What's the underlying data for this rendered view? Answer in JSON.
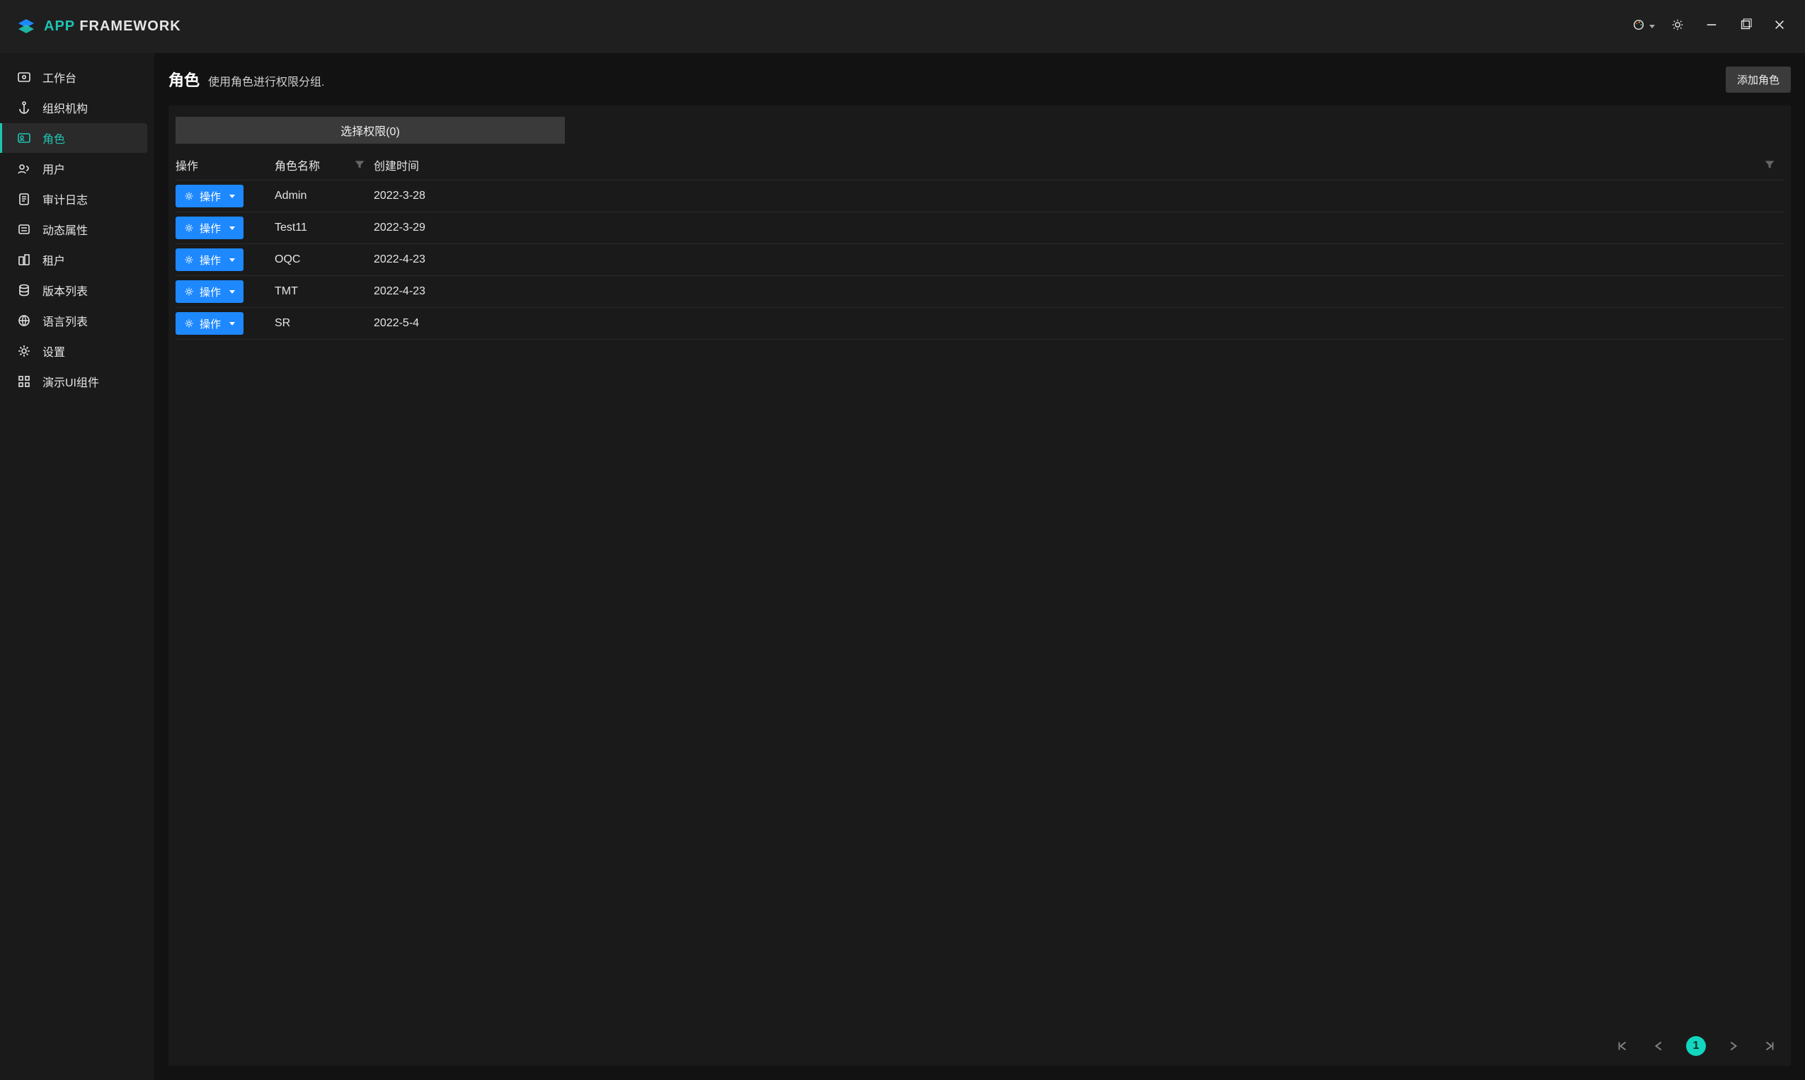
{
  "brand": {
    "accent": "APP",
    "rest": "FRAMEWORK"
  },
  "titlebar": {
    "icons": [
      "language",
      "theme-toggle",
      "minimize",
      "maximize",
      "close"
    ]
  },
  "sidebar": {
    "items": [
      {
        "key": "dashboard",
        "label": "工作台",
        "icon": "dashboard"
      },
      {
        "key": "org",
        "label": "组织机构",
        "icon": "anchor"
      },
      {
        "key": "roles",
        "label": "角色",
        "icon": "id-card",
        "active": true
      },
      {
        "key": "users",
        "label": "用户",
        "icon": "users"
      },
      {
        "key": "audit",
        "label": "审计日志",
        "icon": "clipboard"
      },
      {
        "key": "dynprops",
        "label": "动态属性",
        "icon": "list"
      },
      {
        "key": "tenants",
        "label": "租户",
        "icon": "buildings"
      },
      {
        "key": "versions",
        "label": "版本列表",
        "icon": "database"
      },
      {
        "key": "languages",
        "label": "语言列表",
        "icon": "globe"
      },
      {
        "key": "settings",
        "label": "设置",
        "icon": "gear"
      },
      {
        "key": "demo",
        "label": "演示UI组件",
        "icon": "grid"
      }
    ]
  },
  "page": {
    "title": "角色",
    "subtitle": "使用角色进行权限分组.",
    "add_button": "添加角色"
  },
  "filter_dropdown_label": "选择权限(0)",
  "table": {
    "columns": {
      "op": "操作",
      "name": "角色名称",
      "created": "创建时间"
    },
    "op_label": "操作",
    "rows": [
      {
        "name": "Admin",
        "created": "2022-3-28"
      },
      {
        "name": "Test11",
        "created": "2022-3-29"
      },
      {
        "name": "OQC",
        "created": "2022-4-23"
      },
      {
        "name": "TMT",
        "created": "2022-4-23"
      },
      {
        "name": "SR",
        "created": "2022-5-4"
      }
    ]
  },
  "pager": {
    "current": "1"
  }
}
